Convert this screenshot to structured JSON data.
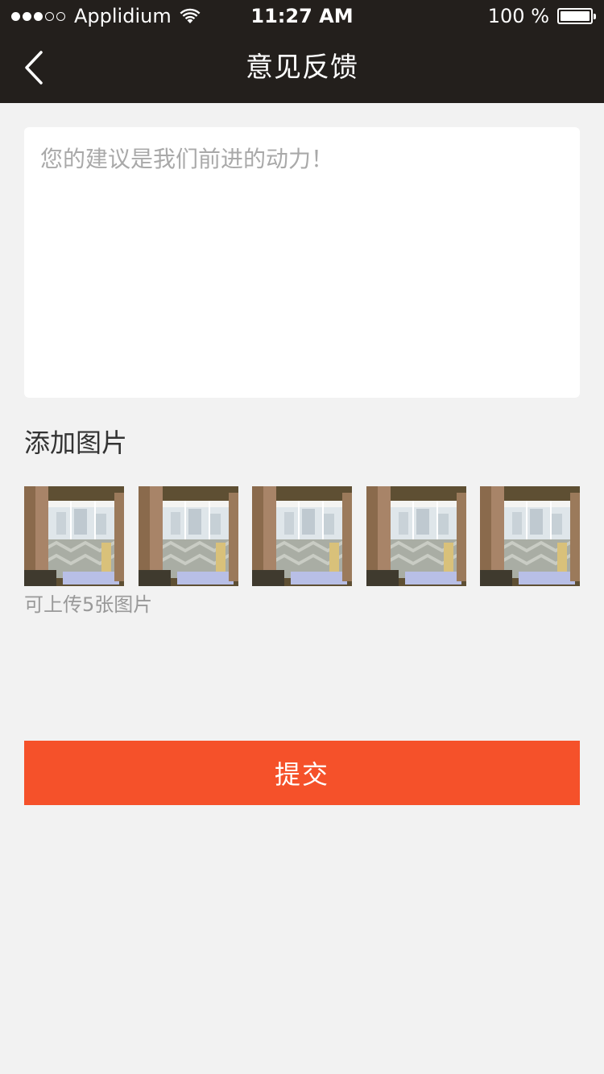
{
  "status_bar": {
    "carrier": "Applidium",
    "time": "11:27 AM",
    "battery": "100 %",
    "signal_bars": 3,
    "signal_total": 5
  },
  "nav": {
    "title": "意见反馈",
    "back_icon": "chevron-left-icon"
  },
  "feedback": {
    "placeholder": "您的建议是我们前进的动力！",
    "value": ""
  },
  "images": {
    "title": "添加图片",
    "hint": "可上传5张图片",
    "thumbnails": [
      {
        "label": "room-photo"
      },
      {
        "label": "room-photo"
      },
      {
        "label": "room-photo"
      },
      {
        "label": "room-photo"
      },
      {
        "label": "room-photo"
      }
    ]
  },
  "submit": {
    "label": "提交"
  },
  "colors": {
    "bar_background": "#231f1c",
    "page_background": "#f2f2f2",
    "accent": "#f5512a"
  }
}
